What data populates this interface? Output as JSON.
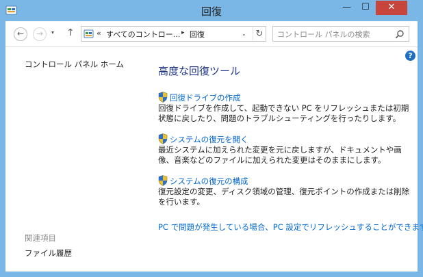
{
  "window": {
    "title": "回復",
    "controls": {
      "minimize": "—",
      "maximize": "☐",
      "close": "✕"
    }
  },
  "navbar": {
    "back": "←",
    "forward": "→",
    "recent": "▾",
    "up": "↑",
    "address": {
      "separator0": "«",
      "crumb1": "すべてのコントロー...",
      "separator1": "▸",
      "crumb2": "回復",
      "dropdown": "⌄",
      "refresh": "↻"
    },
    "search": {
      "placeholder": "コントロール パネルの検索"
    }
  },
  "help": "?",
  "left_pane": {
    "home_link": "コントロール パネル ホーム",
    "related_title": "関連項目",
    "related_links": [
      "ファイル履歴"
    ]
  },
  "main": {
    "title": "高度な回復ツール",
    "tools": [
      {
        "label": "回復ドライブの作成",
        "description": "回復ドライブを作成して、起動できない PC をリフレッシュまたは初期状態に戻したり、問題のトラブルシューティングを行ったりします。"
      },
      {
        "label": "システムの復元を開く",
        "description": "最近システムに加えられた変更を元に戻しますが、ドキュメントや画像、音楽などのファイルに加えられた変更はそのままにします。"
      },
      {
        "label": "システムの復元の構成",
        "description": "復元設定の変更、ディスク領域の管理、復元ポイントの作成または削除を行います。"
      }
    ],
    "pc_settings_link": "PC で問題が発生している場合、PC 設定でリフレッシュすることができます。"
  },
  "colors": {
    "titlebar": "#7ab7e6",
    "close_button": "#c7453b",
    "link": "#0066cc",
    "heading": "#1e3287"
  }
}
